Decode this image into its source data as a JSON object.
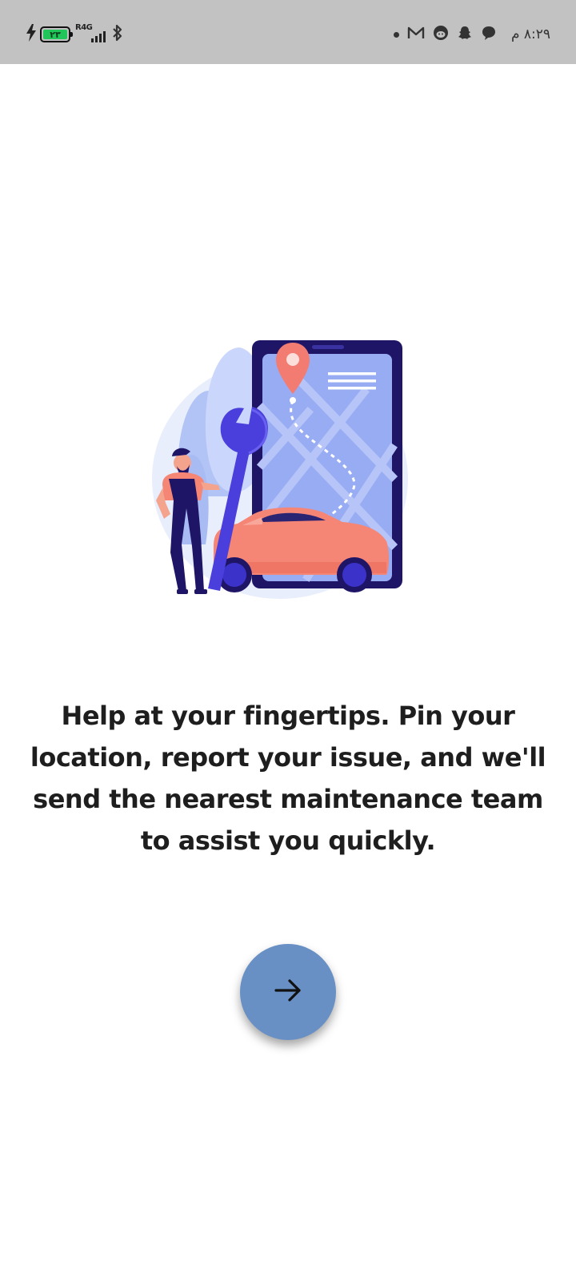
{
  "status_bar": {
    "time": "٨:٢٩ م",
    "battery_level": "٢٣",
    "network_label": "R4G",
    "battery_color": "#21c65a",
    "left_icons": [
      "charging-bolt-icon",
      "battery-icon",
      "signal-icon",
      "bluetooth-icon"
    ],
    "notification_icons": [
      "dot-icon",
      "gmail-icon",
      "reddit-icon",
      "snapchat-icon",
      "chat-bubble-icon"
    ]
  },
  "onboarding": {
    "illustration_icon": "mechanic-car-map-illustration",
    "text": "Help at your fingertips. Pin your location, report your issue, and we'll send the nearest maintenance team to assist you quickly.",
    "next_button_icon": "arrow-right-icon",
    "button_color": "#6990c4"
  }
}
